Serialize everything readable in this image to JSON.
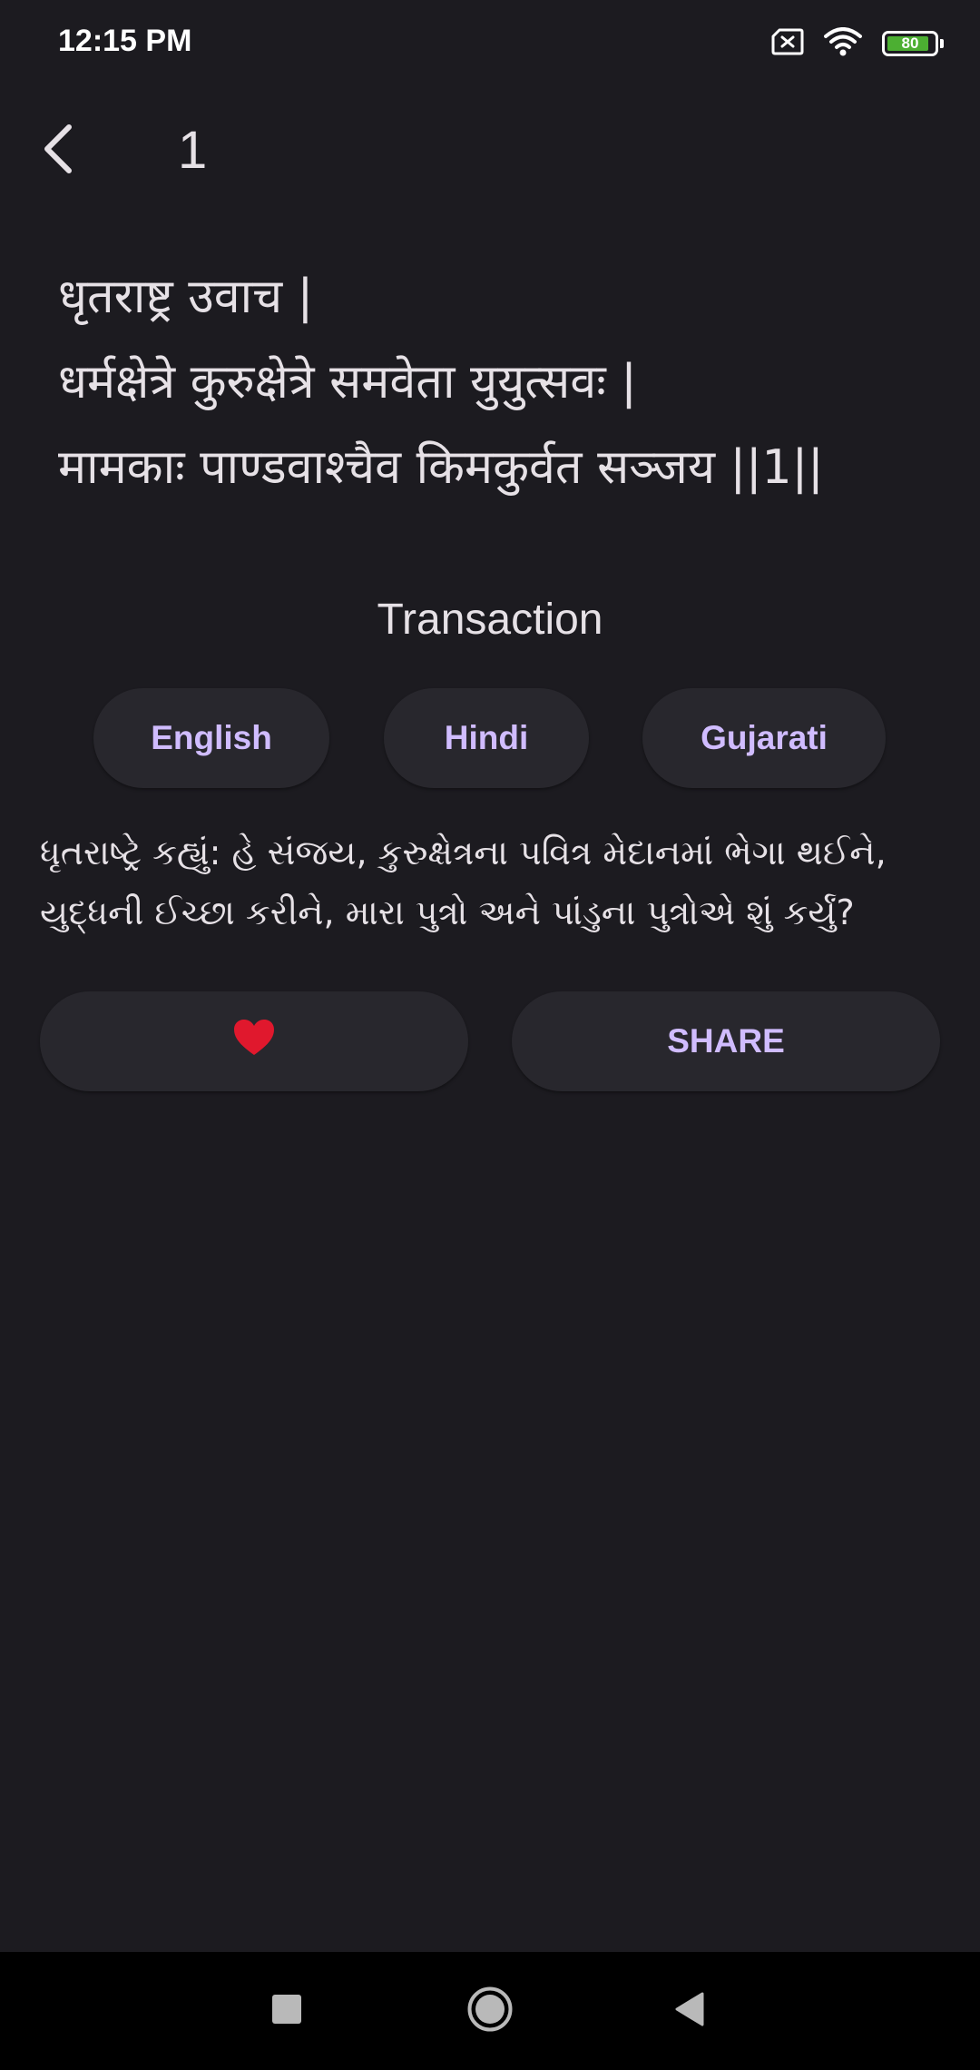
{
  "status_bar": {
    "time": "12:15 PM",
    "battery_level": "80",
    "icons": [
      "sim-error-icon",
      "wifi-icon",
      "battery-icon"
    ]
  },
  "app_bar": {
    "back_icon": "chevron-left-icon",
    "title": "1"
  },
  "verse": {
    "lines": [
      "धृतराष्ट्र उवाच |",
      "धर्मक्षेत्रे कुरुक्षेत्रे समवेता युयुत्सवः |",
      "मामकाः पाण्डवाश्चैव किमकुर्वत सञ्जय ||1||"
    ]
  },
  "translation_section": {
    "title": "Transaction",
    "languages": [
      "English",
      "Hindi",
      "Gujarati"
    ],
    "lines": [
      "ધૃતરાષ્ટ્રે કહ્યું: હે સંજય, કુરુક્ષેત્રના પવિત્ર મેદાનમાં ભેગા થઈને,",
      "યુદ્ધની ઈચ્છા કરીને, મારા પુત્રો અને પાંડુના પુત્રોએ શું કર્યું?"
    ]
  },
  "actions": {
    "favorite_icon": "❤️",
    "share_label": "SHARE"
  },
  "navigation_bar": {
    "icons": [
      "recents-square-icon",
      "home-circle-icon",
      "back-triangle-icon"
    ]
  },
  "colors": {
    "background": "#1c1b20",
    "surface": "#28272d",
    "accent": "#d0bcff",
    "text": "#e6e1e6",
    "battery": "#4caf32",
    "heart": "#e0182d"
  }
}
